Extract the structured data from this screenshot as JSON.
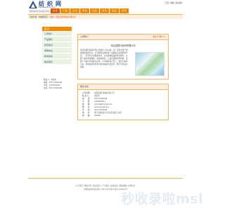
{
  "header": {
    "logo_text": "纺 织 网",
    "logo_url": "www.fangzhi.com.cn",
    "slogan": "中国纺织网 纺织品供求信息平台",
    "top_links": "首页 | 收藏 | 联系我们",
    "nav": [
      "首 页",
      "产 品",
      "企 业",
      "求 购",
      "供 应",
      "资 讯",
      "展 会",
      "招 聘"
    ]
  },
  "breadcrumb": {
    "prefix": "当前位置：纺织网首页 > 企业 >",
    "current": "永嘉县银行纺织有限公司"
  },
  "sidebar": {
    "header": "首 页",
    "items": [
      "公司简介",
      "产品展示",
      "供应信息",
      "求购信息",
      "新闻动态",
      "联系我们"
    ],
    "contact": [
      "联系人：黄先生",
      "电话：0577-67652198",
      "手机：13376920517",
      "传真：0577-67652198"
    ]
  },
  "intro": {
    "title": "公司简介",
    "more": "更多公司简介>>",
    "company": "永嘉县银行纺织有限公司",
    "text": "永嘉县银行纺织有限公司成立于2011年，是一家专业生产各类纺织品的企业，公司拥有先进的生产设备和完善的检测手段，一直坚持以质量求生存、以信誉求发展的经营理念，主要产品有各类面料、家纺用品等，产品远销国内外各地，深受广大客户的信赖与好评，公司本着客户至上、诚信为本的宗旨，热诚欢迎新老客户来电来函洽谈业务，携手共创美好未来。"
  },
  "contact": {
    "title": "联系方式",
    "rows": [
      {
        "k": "公司名称：",
        "v": "永嘉县银行纺织有限公司"
      },
      {
        "k": "联 系 人：",
        "v": "黄先生"
      },
      {
        "k": "电　　话：",
        "v": "0577-67652198"
      },
      {
        "k": "手　　机：",
        "v": "13376920517"
      },
      {
        "k": "邮　　箱：",
        "v": "yhgmall@hotmail.com"
      },
      {
        "k": "网　　址：",
        "v": "www.yhgmall.com"
      },
      {
        "k": "传　　真：",
        "v": "0577-67652198"
      },
      {
        "k": "地　　址：",
        "v": "浙江省永嘉县乌牛街道东蒙工业区"
      },
      {
        "k": "邮　　编：",
        "v": "325108"
      }
    ]
  },
  "footer": {
    "links": "关于我们 | 网站声明 | 联系我们 | 广告服务 | 友情链接 | 网站地图 | 招聘信息",
    "copyright": "中国纺织网 版权所有 1997-2019  浙ICP备 12043815号"
  },
  "watermark": "秒收录啦msl",
  "colors": {
    "accent": "#f08a00",
    "link": "#2d4f8c",
    "highlight": "#d94a00"
  }
}
